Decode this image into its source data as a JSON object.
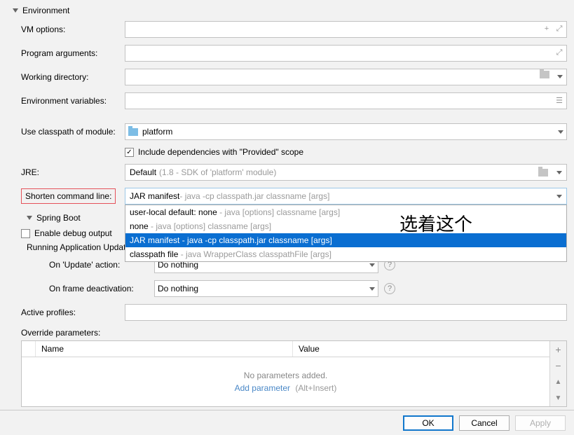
{
  "environment": {
    "title": "Environment",
    "vm_options_label": "VM options:",
    "program_arguments_label": "Program arguments:",
    "working_directory_label": "Working directory:",
    "environment_variables_label": "Environment variables:",
    "use_classpath_label": "Use classpath of module:",
    "classpath_value": "platform",
    "include_deps_label": "Include dependencies with \"Provided\" scope",
    "include_deps_checked": true,
    "jre_label": "JRE:",
    "jre_primary": "Default",
    "jre_secondary": "(1.8 - SDK of 'platform' module)",
    "shorten_label": "Shorten command line:",
    "shorten_selected_primary": "JAR manifest",
    "shorten_selected_secondary": " - java -cp classpath.jar classname [args]",
    "shorten_options": [
      {
        "primary": "user-local default: none",
        "secondary": " - java [options] classname [args]",
        "selected": false
      },
      {
        "primary": "none",
        "secondary": " - java [options] classname [args]",
        "selected": false
      },
      {
        "primary": "JAR manifest",
        "secondary": " - java -cp classpath.jar classname [args]",
        "selected": true
      },
      {
        "primary": "classpath file",
        "secondary": " - java WrapperClass classpathFile [args]",
        "selected": false
      }
    ]
  },
  "spring_boot": {
    "title": "Spring Boot",
    "enable_debug_label": "Enable debug output",
    "update_policies_label": "Running Application Update Policies",
    "on_update_label": "On 'Update' action:",
    "on_update_value": "Do nothing",
    "on_deactivation_label": "On frame deactivation:",
    "on_deactivation_value": "Do nothing",
    "active_profiles_label": "Active profiles:",
    "override_params_label": "Override parameters:",
    "params_col1": "Name",
    "params_col2": "Value",
    "no_params_text": "No parameters added.",
    "add_param_text": "Add parameter",
    "add_param_hint": "(Alt+Insert)"
  },
  "buttons": {
    "ok": "OK",
    "cancel": "Cancel",
    "apply": "Apply"
  },
  "annotation": "选着这个"
}
